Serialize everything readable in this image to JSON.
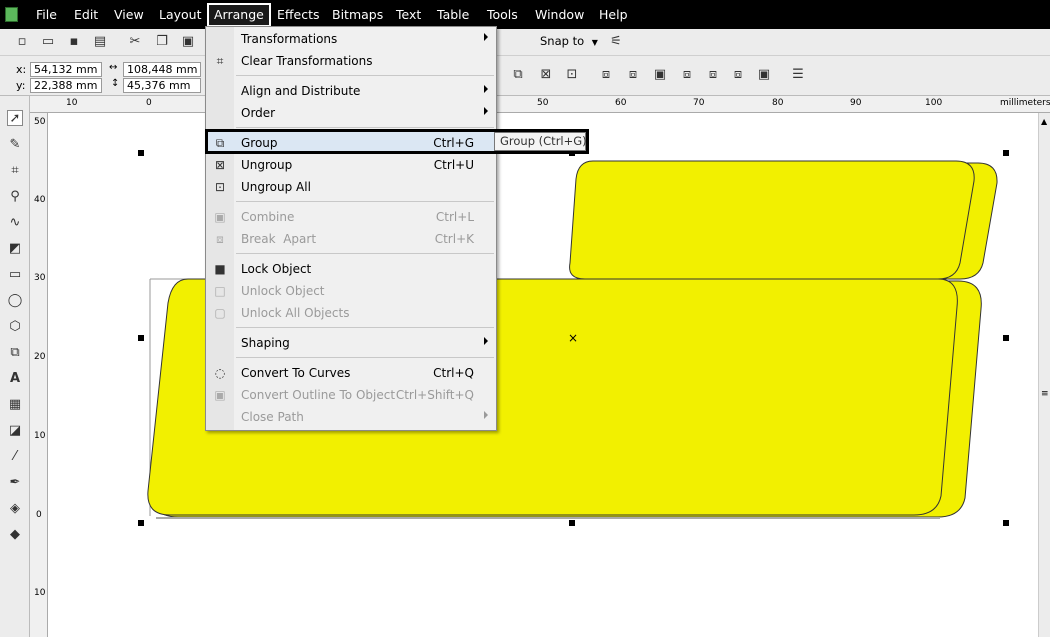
{
  "menubar": {
    "items": [
      "File",
      "Edit",
      "View",
      "Layout",
      "Arrange",
      "Effects",
      "Bitmaps",
      "Text",
      "Table",
      "Tools",
      "Window",
      "Help"
    ],
    "active": "Arrange"
  },
  "toolbar": {
    "snap_label": "Snap to"
  },
  "propbar": {
    "x_label": "x:",
    "x_value": "54,132 mm",
    "y_label": "y:",
    "y_value": "22,388 mm",
    "width_value": "108,448 mm",
    "height_value": "45,376 mm"
  },
  "ruler": {
    "h_ticks": [
      "10",
      "0",
      "50",
      "60",
      "70",
      "80",
      "90",
      "100"
    ],
    "unit": "millimeters",
    "v_ticks": [
      "50",
      "40",
      "30",
      "20",
      "10",
      "0",
      "10"
    ]
  },
  "arrange_menu": {
    "items": [
      {
        "label": "Transformations",
        "shortcut": "",
        "submenu": true,
        "disabled": false,
        "icon": ""
      },
      {
        "label": "Clear Transformations",
        "shortcut": "",
        "submenu": false,
        "disabled": false,
        "icon": "clear-transform-icon"
      },
      {
        "label": "Align and Distribute",
        "shortcut": "",
        "submenu": true,
        "disabled": false,
        "icon": ""
      },
      {
        "label": "Order",
        "shortcut": "",
        "submenu": true,
        "disabled": false,
        "icon": ""
      },
      {
        "label": "Group",
        "shortcut": "Ctrl+G",
        "submenu": false,
        "disabled": false,
        "icon": "group-icon"
      },
      {
        "label": "Ungroup",
        "shortcut": "Ctrl+U",
        "submenu": false,
        "disabled": false,
        "icon": "ungroup-icon"
      },
      {
        "label": "Ungroup All",
        "shortcut": "",
        "submenu": false,
        "disabled": false,
        "icon": "ungroup-all-icon"
      },
      {
        "label": "Combine",
        "shortcut": "Ctrl+L",
        "submenu": false,
        "disabled": true,
        "icon": "combine-icon"
      },
      {
        "label": "Break  Apart",
        "shortcut": "Ctrl+K",
        "submenu": false,
        "disabled": true,
        "icon": "break-apart-icon"
      },
      {
        "label": "Lock Object",
        "shortcut": "",
        "submenu": false,
        "disabled": false,
        "icon": "lock-icon"
      },
      {
        "label": "Unlock Object",
        "shortcut": "",
        "submenu": false,
        "disabled": true,
        "icon": "unlock-icon"
      },
      {
        "label": "Unlock All Objects",
        "shortcut": "",
        "submenu": false,
        "disabled": true,
        "icon": "unlock-all-icon"
      },
      {
        "label": "Shaping",
        "shortcut": "",
        "submenu": true,
        "disabled": false,
        "icon": ""
      },
      {
        "label": "Convert To Curves",
        "shortcut": "Ctrl+Q",
        "submenu": false,
        "disabled": false,
        "icon": "convert-curves-icon"
      },
      {
        "label": "Convert Outline To Object",
        "shortcut": "Ctrl+Shift+Q",
        "submenu": false,
        "disabled": true,
        "icon": "convert-outline-icon"
      },
      {
        "label": "Close Path",
        "shortcut": "",
        "submenu": true,
        "disabled": true,
        "icon": ""
      }
    ]
  },
  "tooltip": "Group (Ctrl+G)",
  "colors": {
    "shape_fill": "#f2f000",
    "menubar_bg": "#000000",
    "menu_bg": "#f0f0f0"
  }
}
